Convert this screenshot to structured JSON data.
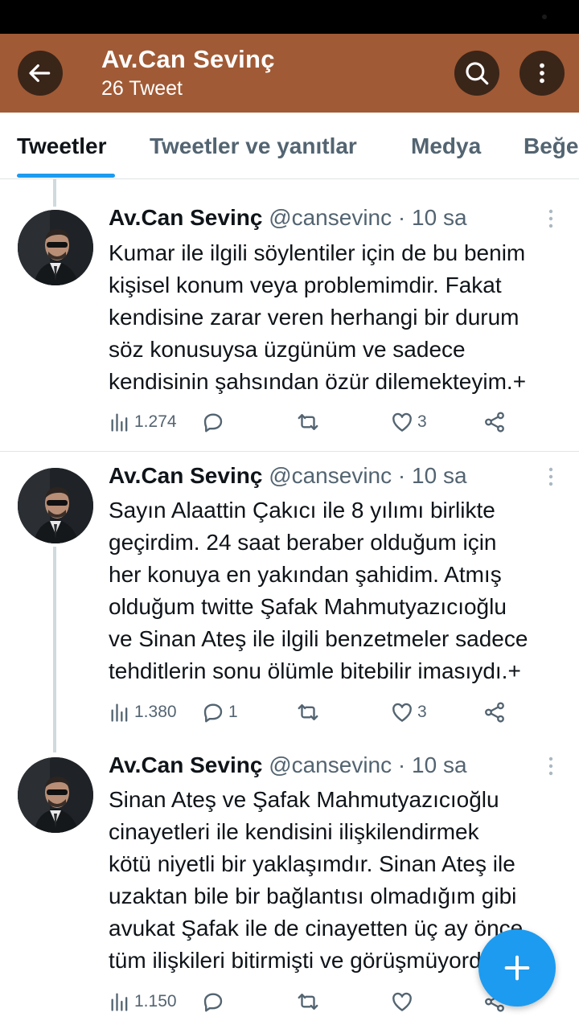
{
  "header": {
    "title": "Av.Can Sevinç",
    "subtitle": "26 Tweet"
  },
  "tabs": [
    {
      "label": "Tweetler",
      "active": true
    },
    {
      "label": "Tweetler ve yanıtlar"
    },
    {
      "label": "Medya"
    },
    {
      "label": "Beğeniler"
    }
  ],
  "tweets": [
    {
      "name": "Av.Can Sevinç",
      "handle": "@cansevinc",
      "sep": " · ",
      "time": "10 sa",
      "text": "Kumar ile ilgili söylentiler için de bu benim\nkişisel konum veya problemimdir. Fakat\nkendisine zarar veren herhangi bir durum\nsöz konusuysa üzgünüm ve sadece\nkendisinin şahsından özür dilemekteyim.+",
      "views": "1.274",
      "replies": "",
      "retweets": "",
      "likes": "3"
    },
    {
      "name": "Av.Can Sevinç",
      "handle": "@cansevinc",
      "sep": " · ",
      "time": "10 sa",
      "text": "Sayın Alaattin Çakıcı ile 8 yılımı birlikte\ngeçirdim. 24 saat beraber olduğum için\nher konuya en yakından şahidim. Atmış\nolduğum twitte Şafak Mahmutyazıcıoğlu\nve Sinan Ateş ile ilgili benzetmeler sadece\ntehditlerin sonu ölümle bitebilir imasıydı.+",
      "views": "1.380",
      "replies": "1",
      "retweets": "",
      "likes": "3"
    },
    {
      "name": "Av.Can Sevinç",
      "handle": "@cansevinc",
      "sep": " · ",
      "time": "10 sa",
      "text": "Sinan Ateş ve Şafak Mahmutyazıcıoğlu\ncinayetleri ile kendisini ilişkilendirmek\nkötü niyetli bir yaklaşımdır. Sinan Ateş ile\nuzaktan bile bir bağlantısı olmadığım gibi\navukat Şafak ile de cinayetten üç ay önce\ntüm ilişkileri bitirmişti ve görüşmüyordu.",
      "views": "1.150",
      "replies": "",
      "retweets": "",
      "likes": ""
    }
  ],
  "colors": {
    "header_bg": "#a05a35",
    "accent": "#1d9bf0",
    "muted": "#536471"
  }
}
